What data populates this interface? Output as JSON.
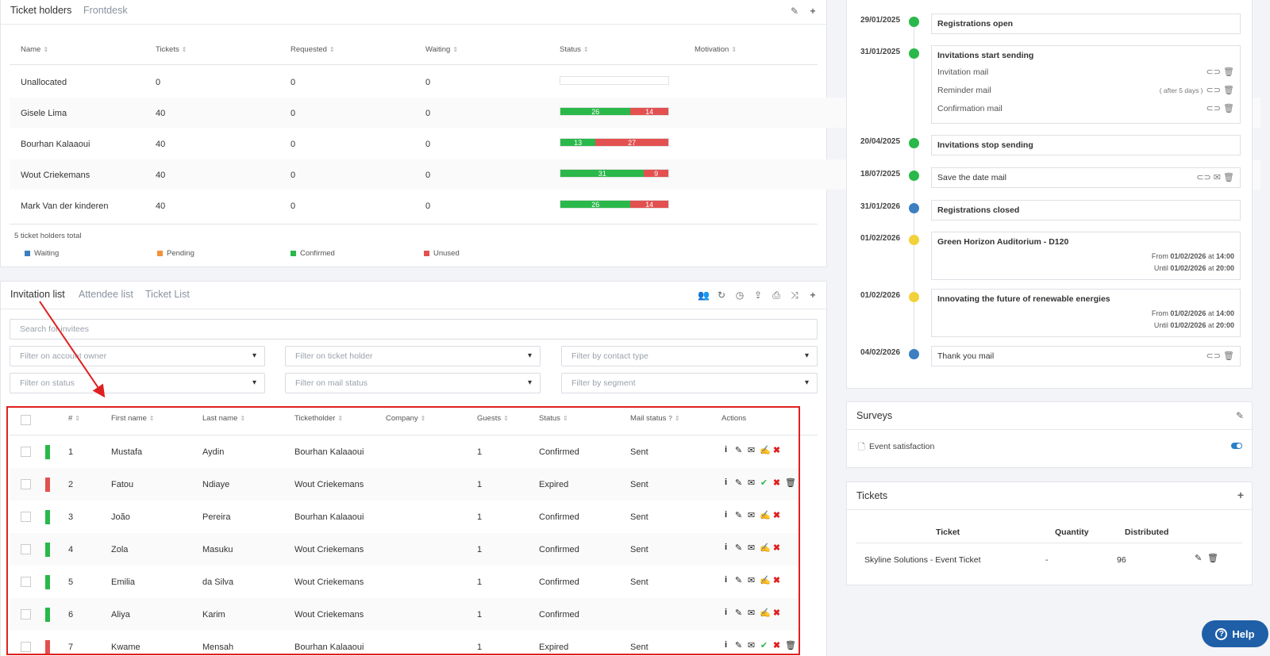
{
  "ticket_holders": {
    "tabs": [
      "Ticket holders",
      "Frontdesk"
    ],
    "columns": [
      "Name",
      "Tickets",
      "Requested",
      "Waiting",
      "Status",
      "Motivation"
    ],
    "rows": [
      {
        "name": "Unallocated",
        "tickets": "0",
        "requested": "0",
        "waiting": "0",
        "confirmed": 0,
        "unused": 0
      },
      {
        "name": "Gisele Lima",
        "tickets": "40",
        "requested": "0",
        "waiting": "0",
        "confirmed": 26,
        "unused": 14
      },
      {
        "name": "Bourhan Kalaaoui",
        "tickets": "40",
        "requested": "0",
        "waiting": "0",
        "confirmed": 13,
        "unused": 27
      },
      {
        "name": "Wout Criekemans",
        "tickets": "40",
        "requested": "0",
        "waiting": "0",
        "confirmed": 31,
        "unused": 9
      },
      {
        "name": "Mark Van der kinderen",
        "tickets": "40",
        "requested": "0",
        "waiting": "0",
        "confirmed": 26,
        "unused": 14
      }
    ],
    "total_label": "5 ticket holders total",
    "legend": [
      {
        "label": "Waiting",
        "color": "#3b7ec2"
      },
      {
        "label": "Pending",
        "color": "#f0923a"
      },
      {
        "label": "Confirmed",
        "color": "#2ab84a"
      },
      {
        "label": "Unused",
        "color": "#e35050"
      }
    ]
  },
  "invitations": {
    "tabs": [
      "Invitation list",
      "Attendee list",
      "Ticket List"
    ],
    "search_placeholder": "Search for invitees",
    "filters": [
      "Filter on account owner",
      "Filter on ticket holder",
      "Filter by contact type",
      "Filter on status",
      "Filter on mail status",
      "Filter by segment"
    ],
    "columns": [
      "#",
      "First name",
      "Last name",
      "Ticketholder",
      "Company",
      "Guests",
      "Status",
      "Mail status",
      "Actions"
    ],
    "rows": [
      {
        "num": "1",
        "first": "Mustafa",
        "last": "Aydin",
        "holder": "Bourhan Kalaaoui",
        "company": "",
        "guests": "1",
        "status": "Confirmed",
        "mail": "Sent",
        "color": "#2ab84a"
      },
      {
        "num": "2",
        "first": "Fatou",
        "last": "Ndiaye",
        "holder": "Wout Criekemans",
        "company": "",
        "guests": "1",
        "status": "Expired",
        "mail": "Sent",
        "color": "#e35050"
      },
      {
        "num": "3",
        "first": "João",
        "last": "Pereira",
        "holder": "Bourhan Kalaaoui",
        "company": "",
        "guests": "1",
        "status": "Confirmed",
        "mail": "Sent",
        "color": "#2ab84a"
      },
      {
        "num": "4",
        "first": "Zola",
        "last": "Masuku",
        "holder": "Wout Criekemans",
        "company": "",
        "guests": "1",
        "status": "Confirmed",
        "mail": "Sent",
        "color": "#2ab84a"
      },
      {
        "num": "5",
        "first": "Emilia",
        "last": "da Silva",
        "holder": "Wout Criekemans",
        "company": "",
        "guests": "1",
        "status": "Confirmed",
        "mail": "Sent",
        "color": "#2ab84a"
      },
      {
        "num": "6",
        "first": "Aliya",
        "last": "Karim",
        "holder": "Wout Criekemans",
        "company": "",
        "guests": "1",
        "status": "Confirmed",
        "mail": "",
        "color": "#2ab84a"
      },
      {
        "num": "7",
        "first": "Kwame",
        "last": "Mensah",
        "holder": "Bourhan Kalaaoui",
        "company": "",
        "guests": "1",
        "status": "Expired",
        "mail": "Sent",
        "color": "#e35050"
      }
    ]
  },
  "timeline": [
    {
      "date": "29/01/2025",
      "title": "Registrations open",
      "dot": "#2ab84a"
    },
    {
      "date": "31/01/2025",
      "title": "Invitations start sending",
      "dot": "#2ab84a",
      "mails": [
        {
          "label": "Invitation mail",
          "note": ""
        },
        {
          "label": "Reminder mail",
          "note": "( after 5 days )"
        },
        {
          "label": "Confirmation mail",
          "note": ""
        }
      ]
    },
    {
      "date": "20/04/2025",
      "title": "Invitations stop sending",
      "dot": "#2ab84a"
    },
    {
      "date": "18/07/2025",
      "title": "Save the date mail",
      "dot": "#2ab84a"
    },
    {
      "date": "31/01/2026",
      "title": "Registrations closed",
      "dot": "#3b7ec2"
    },
    {
      "date": "01/02/2026",
      "title": "Green Horizon Auditorium - D120",
      "dot": "#f2d23a",
      "from": "01/02/2026",
      "until": "01/02/2026",
      "time_from": "14:00",
      "time_until": "20:00"
    },
    {
      "date": "01/02/2026",
      "title": "Innovating the future of renewable energies",
      "dot": "#f2d23a",
      "from": "01/02/2026",
      "until": "01/02/2026",
      "time_from": "14:00",
      "time_until": "20:00"
    },
    {
      "date": "04/02/2026",
      "title": "Thank you mail",
      "dot": "#3b7ec2"
    }
  ],
  "timeline_words": {
    "from": "From",
    "until": "Until",
    "at": "at"
  },
  "surveys": {
    "title": "Surveys",
    "items": [
      "Event satisfaction"
    ]
  },
  "tickets": {
    "title": "Tickets",
    "columns": [
      "Ticket",
      "Quantity",
      "Distributed"
    ],
    "rows": [
      {
        "ticket": "Skyline Solutions - Event Ticket",
        "quantity": "-",
        "distributed": "96"
      }
    ]
  },
  "help_label": "Help"
}
